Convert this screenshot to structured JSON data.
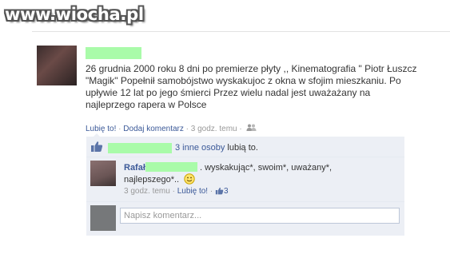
{
  "watermark": "www.wiocha.pl",
  "post": {
    "text": "26 grudnia 2000 roku 8 dni po premierze płyty ,, Kinematografia \" Piotr Łuszcz \"Magik\" Popełnił samobójstwo wyskakujoc z okna w sfojim mieszkaniu. Po upływie 12 lat po jego śmierci Przez wielu nadal jest uważażany na najleprzego rapera w Polsce",
    "actions": {
      "like": "Lubię to!",
      "separator": "·",
      "comment": "Dodaj komentarz",
      "time": "3 godz. temu",
      "audience_icon": "friends-icon"
    }
  },
  "likes": {
    "others": "3 inne osoby",
    "suffix": "lubią to."
  },
  "comment": {
    "author": "Rafał",
    "text_line1": ". wyskakując*, swoim*, uważany*,",
    "text_line2": "najlepszego*..",
    "emoticon": "smiley-icon",
    "time": "3 godz. temu",
    "separator": "·",
    "like": "Lubię to!",
    "like_count": "3"
  },
  "write_comment": {
    "placeholder": "Napisz komentarz..."
  },
  "colors": {
    "link": "#3b5998",
    "feedback_bg": "#eceff5",
    "redaction": "#a9fba9"
  }
}
